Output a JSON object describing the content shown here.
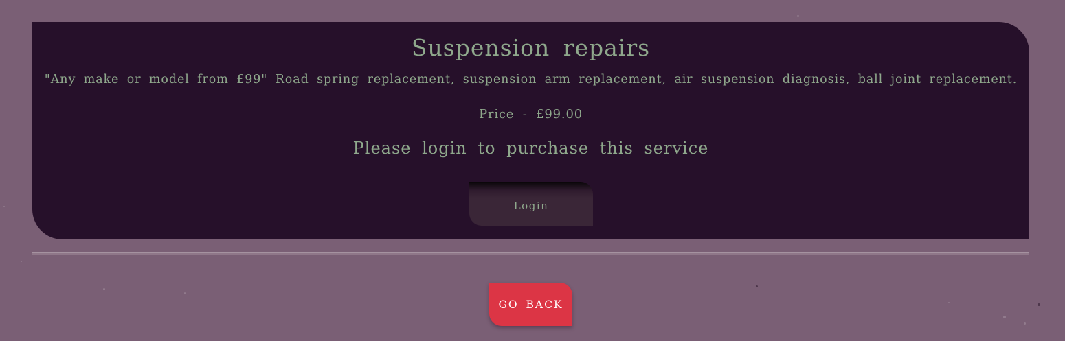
{
  "service": {
    "title": "Suspension repairs",
    "description": "\"Any make or model from £99\" Road spring replacement, suspension arm replacement, air suspension diagnosis, ball joint replacement.",
    "price_text": "Price - £99.00",
    "login_prompt": "Please login to purchase this service",
    "login_button_label": "Login"
  },
  "navigation": {
    "go_back_label": "GO BACK"
  },
  "colors": {
    "page_background": "#7a5f75",
    "card_background": "#26102a",
    "text_accent": "#8fa88c",
    "go_back_button": "#dc3545"
  }
}
